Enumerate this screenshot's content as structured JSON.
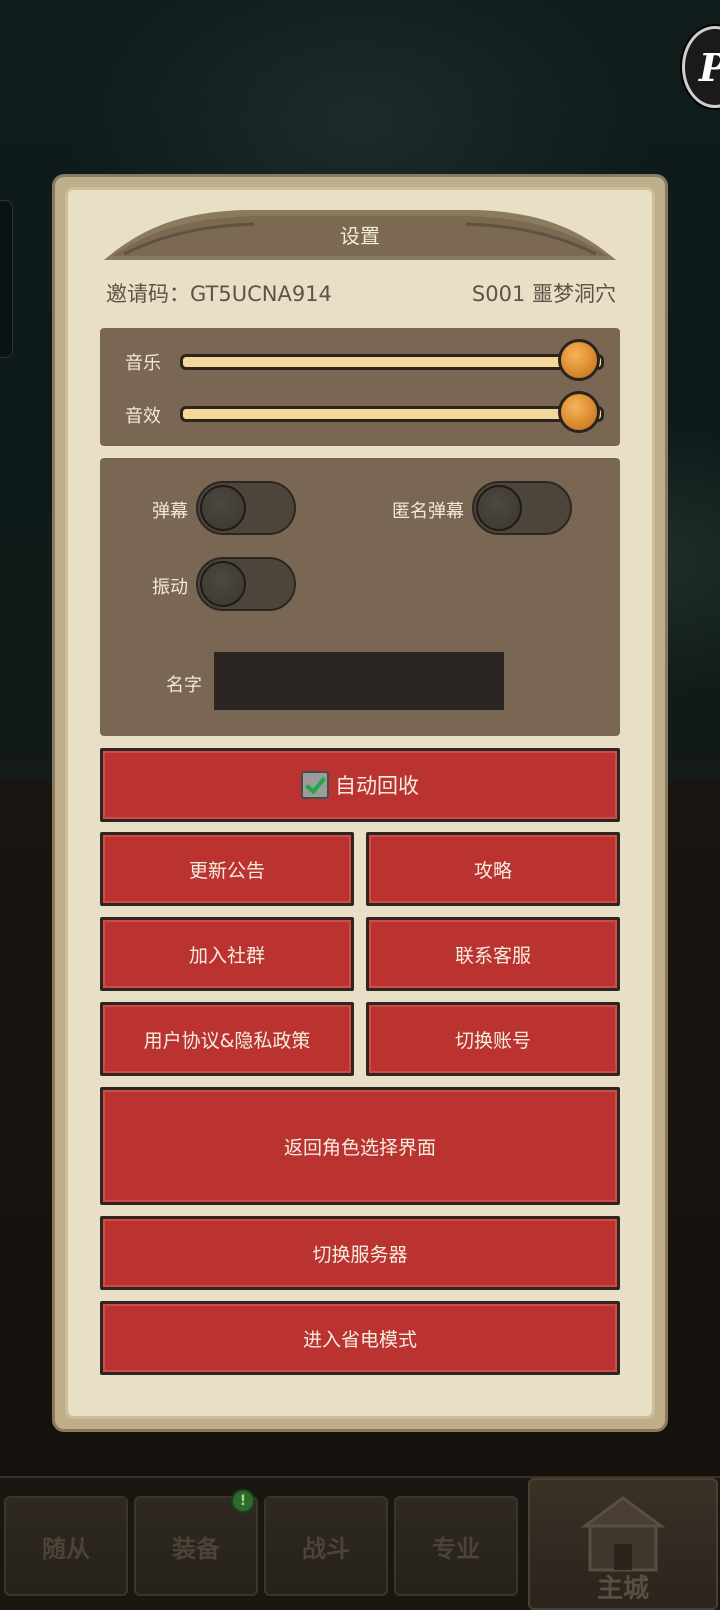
{
  "dialog": {
    "title": "设置",
    "invite_label": "邀请码：GT5UCNA914",
    "server_label": "S001 噩梦洞穴"
  },
  "sound": {
    "music_label": "音乐",
    "music_level": 1.0,
    "sfx_label": "音效",
    "sfx_level": 1.0
  },
  "switches": {
    "danmaku_label": "弹幕",
    "danmaku_on": false,
    "anon_danmaku_label": "匿名弹幕",
    "anon_danmaku_on": false,
    "vibration_label": "振动",
    "vibration_on": false,
    "name_label": "名字"
  },
  "buttons": {
    "auto_recycle": "自动回收",
    "auto_recycle_checked": true,
    "update_notice": "更新公告",
    "guide": "攻略",
    "join_community": "加入社群",
    "contact_support": "联系客服",
    "user_agreement": "用户协议&隐私政策",
    "switch_account": "切换账号",
    "back_to_character_select": "返回角色选择界面",
    "switch_server": "切换服务器",
    "power_save_mode": "进入省电模式"
  },
  "bottom_nav": {
    "followers": "随从",
    "equipment": "装备",
    "equipment_badge": "!",
    "battle": "战斗",
    "profession": "专业",
    "main_city": "主城"
  },
  "colors": {
    "button_red": "#bb3331",
    "panel_brown": "#7a6753",
    "parchment": "#e9dfc6",
    "slider_fill": "#f3d79b",
    "knob_orange": "#d9882c"
  }
}
